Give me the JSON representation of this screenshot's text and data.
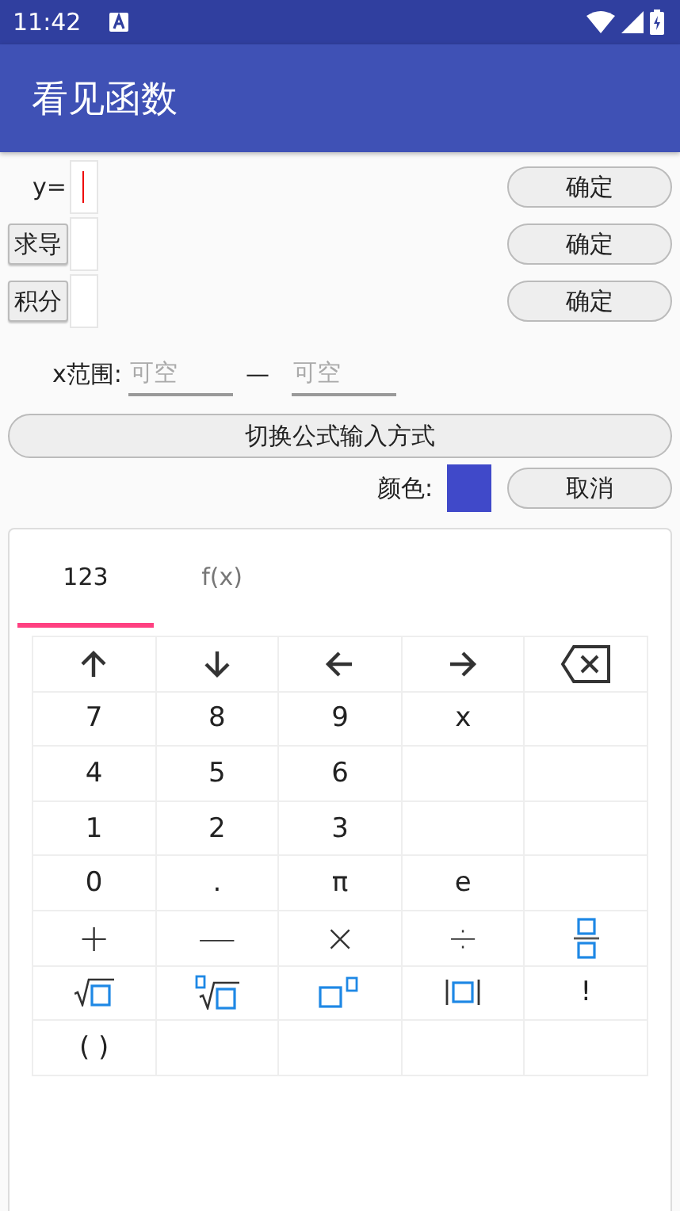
{
  "status_bar": {
    "time": "11:42"
  },
  "app_bar": {
    "title": "看见函数"
  },
  "formula_rows": [
    {
      "kind": "label",
      "label": "y=",
      "focused": true,
      "confirm": "确定"
    },
    {
      "kind": "button",
      "label": "求导",
      "focused": false,
      "confirm": "确定"
    },
    {
      "kind": "button",
      "label": "积分",
      "focused": false,
      "confirm": "确定"
    }
  ],
  "x_range": {
    "label": "x范围:",
    "from_placeholder": "可空",
    "separator": "—",
    "to_placeholder": "可空"
  },
  "switch_button": "切换公式输入方式",
  "color_row": {
    "label": "颜色:",
    "color": "#4049c9",
    "cancel": "取消"
  },
  "keyboard": {
    "tabs": [
      {
        "label": "123",
        "selected": true
      },
      {
        "label": "f(x)",
        "selected": false
      }
    ],
    "keys": [
      {
        "kind": "up"
      },
      {
        "kind": "down"
      },
      {
        "kind": "left"
      },
      {
        "kind": "right"
      },
      {
        "kind": "backspace"
      },
      {
        "kind": "text",
        "label": "7"
      },
      {
        "kind": "text",
        "label": "8"
      },
      {
        "kind": "text",
        "label": "9"
      },
      {
        "kind": "text",
        "label": "x"
      },
      {
        "kind": "empty"
      },
      {
        "kind": "text",
        "label": "4"
      },
      {
        "kind": "text",
        "label": "5"
      },
      {
        "kind": "text",
        "label": "6"
      },
      {
        "kind": "empty"
      },
      {
        "kind": "empty"
      },
      {
        "kind": "text",
        "label": "1"
      },
      {
        "kind": "text",
        "label": "2"
      },
      {
        "kind": "text",
        "label": "3"
      },
      {
        "kind": "empty"
      },
      {
        "kind": "empty"
      },
      {
        "kind": "text",
        "label": "0"
      },
      {
        "kind": "text",
        "label": "."
      },
      {
        "kind": "text",
        "label": "π"
      },
      {
        "kind": "text",
        "label": "e"
      },
      {
        "kind": "empty"
      },
      {
        "kind": "op",
        "label": "+"
      },
      {
        "kind": "op",
        "label": "—"
      },
      {
        "kind": "op",
        "label": "×"
      },
      {
        "kind": "op",
        "label": "÷"
      },
      {
        "kind": "fraction"
      },
      {
        "kind": "sqrt"
      },
      {
        "kind": "nthroot"
      },
      {
        "kind": "power"
      },
      {
        "kind": "abs"
      },
      {
        "kind": "text",
        "label": "!"
      },
      {
        "kind": "text",
        "label": "( )"
      },
      {
        "kind": "empty"
      },
      {
        "kind": "empty"
      },
      {
        "kind": "empty"
      },
      {
        "kind": "empty"
      }
    ]
  }
}
